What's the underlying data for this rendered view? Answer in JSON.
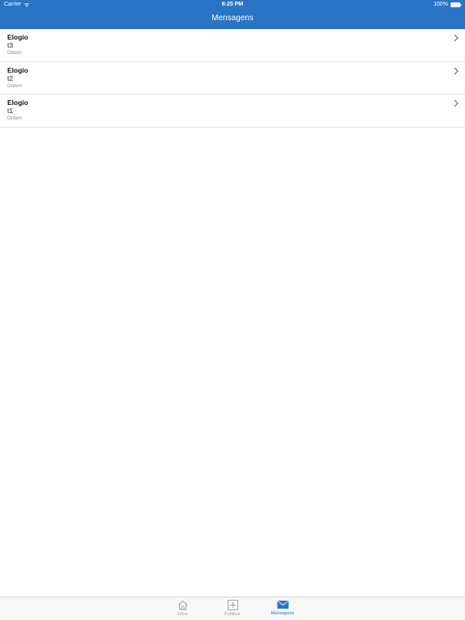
{
  "status_bar": {
    "carrier": "Carrier",
    "time": "6:25 PM",
    "battery": "100%",
    "wifi_icon": "wifi-icon",
    "battery_icon": "battery-icon"
  },
  "nav": {
    "title": "Mensagens"
  },
  "messages": [
    {
      "title": "Elogio",
      "subject": "t3",
      "date": "Ontem"
    },
    {
      "title": "Elogio",
      "subject": "t2",
      "date": "Ontem"
    },
    {
      "title": "Elogio",
      "subject": "t1",
      "date": "Ontem"
    }
  ],
  "tabbar": {
    "tabs": [
      {
        "label": "Início",
        "icon": "home-icon",
        "active": false
      },
      {
        "label": "Publicar",
        "icon": "plus-square-icon",
        "active": false
      },
      {
        "label": "Mensagens",
        "icon": "envelope-icon",
        "active": true
      }
    ]
  },
  "colors": {
    "accent": "#2a74c5",
    "inactive_tab": "#9a9a9e",
    "separator": "#e1e1e3"
  }
}
